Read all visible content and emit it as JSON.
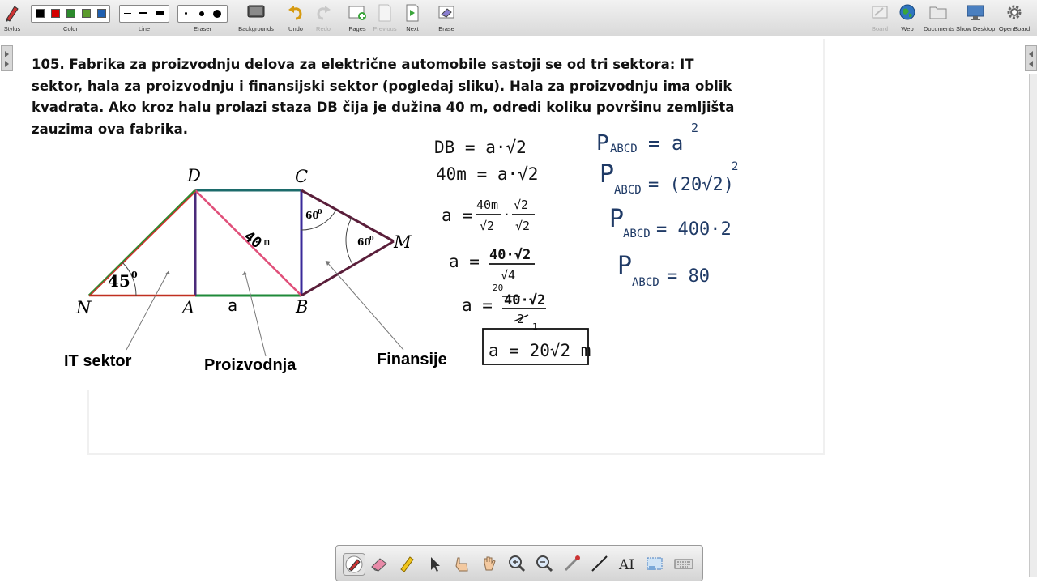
{
  "toolbar": {
    "stylus": "Stylus",
    "color": "Color",
    "line": "Line",
    "eraser": "Eraser",
    "backgrounds": "Backgrounds",
    "undo": "Undo",
    "redo": "Redo",
    "pages": "Pages",
    "previous": "Previous",
    "next": "Next",
    "erase": "Erase",
    "board": "Board",
    "web": "Web",
    "documents": "Documents",
    "show_desktop": "Show Desktop",
    "openboard": "OpenBoard",
    "colors": [
      "#000000",
      "#d40000",
      "#2c8a2c",
      "#5b9b2c",
      "#1f5fb0"
    ]
  },
  "problem": {
    "text": "105. Fabrika za proizvodnju delova za električne automobile sastoji se od tri sektora: IT sektor, hala za proizvodnju i finansijski sektor (pogledaj sliku). Hala za proizvodnju ima oblik kvadrata. Ako kroz halu prolazi staza DB čija je dužina 40 m, odredi koliku površinu zemljišta zauzima ova fabrika."
  },
  "figure": {
    "point_d": "D",
    "point_c": "C",
    "point_n": "N",
    "point_a": "A",
    "point_b": "B",
    "point_m": "M",
    "angle_45": "45",
    "angle_60_c": "60",
    "angle_60_m": "60",
    "degree": "0",
    "side_a": "a",
    "diag_40": "40",
    "diag_unit": "m",
    "label_it": "IT sektor",
    "label_proizvodnja": "Proizvodnja",
    "label_finansije": "Finansije"
  },
  "work_left": {
    "l1": "DB = a·√2",
    "l2": "40m = a·√2",
    "l3_a": "a =",
    "l3_num": "40m",
    "l3_den": "√2",
    "l3_dot": "·",
    "l3_num2": "√2",
    "l3_den2": "√2",
    "l4_a": "a =",
    "l4_num": "40·√2",
    "l4_den": "√4",
    "l5_a": "a =",
    "l5_top": "20",
    "l5_num": "40·√2",
    "l5_den": "2",
    "l5_sub": "1",
    "result": "a = 20√2 m"
  },
  "work_right": {
    "r1": "P",
    "r1_sub": "ABCD",
    "r1_eq": "= a",
    "r1_sup": "2",
    "r2": "P",
    "r2_sub": "ABCD",
    "r2_eq": "= (20√2)",
    "r2_sup": "2",
    "r3": "P",
    "r3_sub": "ABCD",
    "r3_eq": "= 400·2",
    "r4": "P",
    "r4_sub": "ABCD",
    "r4_eq": "= 80"
  }
}
